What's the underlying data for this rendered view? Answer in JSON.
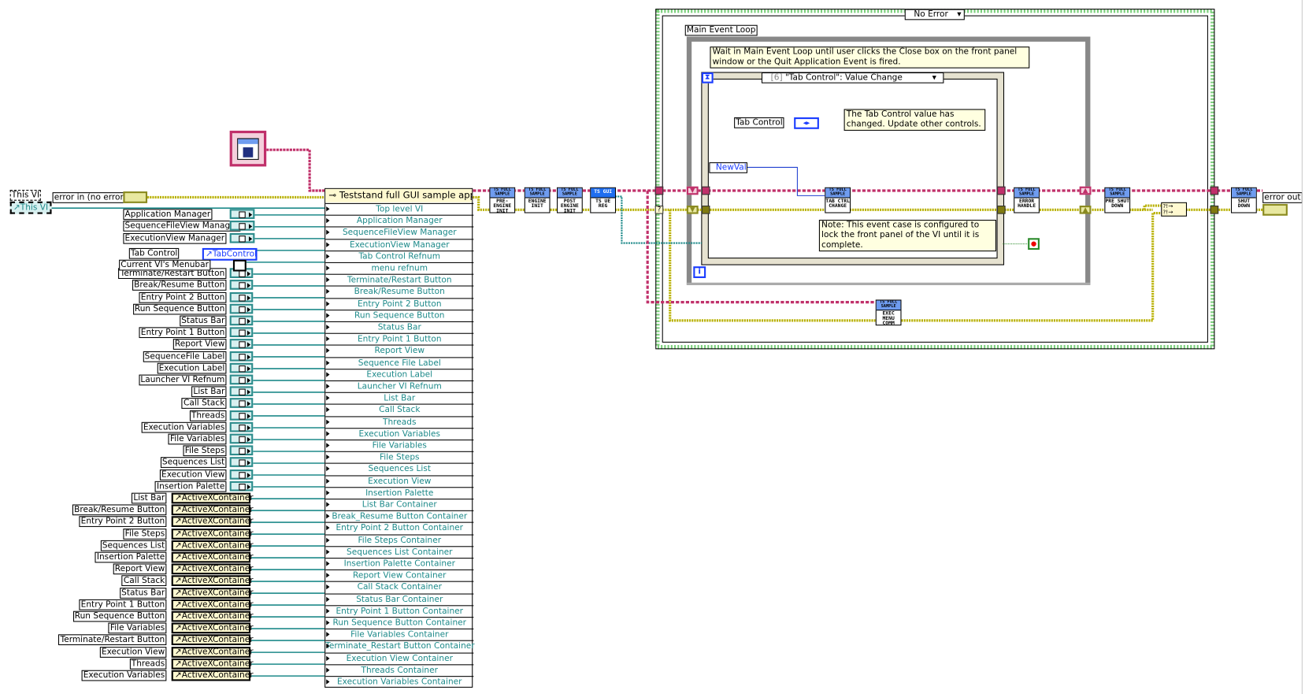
{
  "colors": {
    "error_wire": "#b8b000",
    "refnum_wire": "#c0306a",
    "object_wire": "#1e8a8a",
    "case_border": "#7ccf7c",
    "loop_border": "#888888"
  },
  "left": {
    "this_vi_label": "This VI",
    "this_vi_ref": "This VI",
    "error_in_label": "error in (no error)",
    "managers": [
      "Application Manager",
      "SequenceFileView Manager",
      "ExecutionView Manager"
    ],
    "tab_control_label": "Tab Control",
    "tab_control_ref": "TabControl",
    "menubar_label": "Current VI's Menubar",
    "controls": [
      "Terminate/Restart Button",
      "Break/Resume Button",
      "Entry Point 2 Button",
      "Run Sequence Button",
      "Status Bar",
      "Entry Point 1 Button",
      "Report View",
      "SequenceFile Label",
      "Execution Label",
      "Launcher VI Refnum",
      "List Bar",
      "Call Stack",
      "Threads",
      "Execution Variables",
      "File Variables",
      "File Steps",
      "Sequences List",
      "Execution View",
      "Insertion Palette"
    ],
    "containers": [
      "List Bar",
      "Break/Resume Button",
      "Entry Point 2 Button",
      "File Steps",
      "Sequences List",
      "Insertion Palette",
      "Report View",
      "Call Stack",
      "Status Bar",
      "Entry Point 1 Button",
      "Run Sequence Button",
      "File Variables",
      "Terminate/Restart Button",
      "Execution View",
      "Threads",
      "Execution Variables"
    ],
    "container_ref_label": "ActiveXContainer"
  },
  "bundle": {
    "title": "Teststand full GUI sample appli",
    "items": [
      "Top level VI",
      "Application Manager",
      "SequenceFileView Manager",
      "ExecutionView Manager",
      "Tab Control Refnum",
      "menu refnum",
      "Terminate/Restart Button",
      "Break/Resume Button",
      "Entry Point 2 Button",
      "Run Sequence Button",
      "Status Bar",
      "Entry Point 1 Button",
      "Report View",
      "Sequence File Label",
      "Execution Label",
      "Launcher VI Refnum",
      "List Bar",
      "Call Stack",
      "Threads",
      "Execution Variables",
      "File Variables",
      "File Steps",
      "Sequences List",
      "Execution View",
      "Insertion Palette",
      "List Bar Container",
      "Break_Resume Button Container",
      "Entry Point 2 Button Container",
      "File Steps Container",
      "Sequences List Container",
      "Insertion Palette Container",
      "Report View Container",
      "Call Stack Container",
      "Status Bar Container",
      "Entry Point 1 Button Container",
      "Run Sequence Button Container",
      "File Variables Container",
      "Terminate_Restart Button Container",
      "Execution View Container",
      "Threads Container",
      "Execution Variables Container"
    ]
  },
  "subvis": {
    "header": "TS FULL SAMPLE",
    "pre_engine_init": "PRE-ENGINE INIT",
    "engine_init": "ENGINE INIT",
    "post_engine_init": "POST ENGINE INIT",
    "ts_gui_header": "TS GUI",
    "ts_ue_reg": "TS UE REG",
    "tab_ctrl_change": "TAB CTRL CHANGE",
    "error_handle": "ERROR HANDLE",
    "pre_shut_down": "PRE SHUT DOWN",
    "exec_menu_comm": "EXEC MENU COMM",
    "shut_down": "SHUT DOWN"
  },
  "case_structure": {
    "selector": "No Error"
  },
  "while_loop": {
    "label": "Main Event Loop",
    "comment": "Wait in Main Event Loop until user clicks the Close box on the front panel window or the Quit Application Event is fired.",
    "iteration": "i"
  },
  "event_structure": {
    "case_index": "[6]",
    "case_name": "\"Tab Control\": Value Change",
    "tab_control_label": "Tab Control",
    "comment": "The Tab Control value has changed. Update other controls.",
    "newval": "NewVal",
    "note": "Note: This event case is configured to lock the front panel of the VI until it is complete."
  },
  "right": {
    "error_out_label": "error out"
  }
}
